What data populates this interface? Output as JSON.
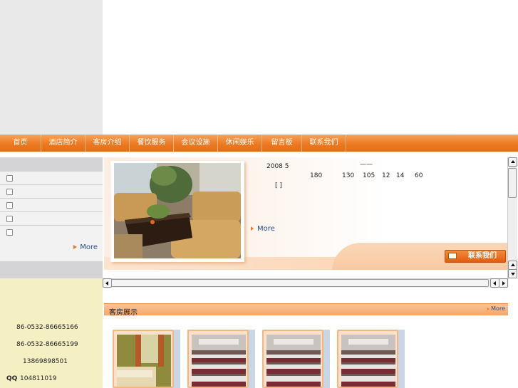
{
  "nav": {
    "items": [
      "首页",
      "酒店简介",
      "客房介绍",
      "餐饮服务",
      "会议设施",
      "休闲娱乐",
      "留言板",
      "联系我们"
    ]
  },
  "sidebar": {
    "more_label": "More"
  },
  "banner": {
    "line1_year": "2008 5",
    "line1_dash": "——",
    "line2_numbers": [
      "180",
      "130",
      "105",
      "12",
      "14",
      "60"
    ],
    "line3_brackets": "[   ]",
    "more_label": "More",
    "contact_button": "联系我们"
  },
  "contact": {
    "phone1": "86-0532-86665166",
    "phone2": "86-0532-86665199",
    "mobile": "13869898501",
    "qq_label": "QQ",
    "qq_number": "104811019"
  },
  "section": {
    "title": "客房展示",
    "more_label": "More"
  },
  "colors": {
    "accent": "#ec7a22",
    "link": "#2b4f8a",
    "contact_bg": "#f4f0c4"
  }
}
